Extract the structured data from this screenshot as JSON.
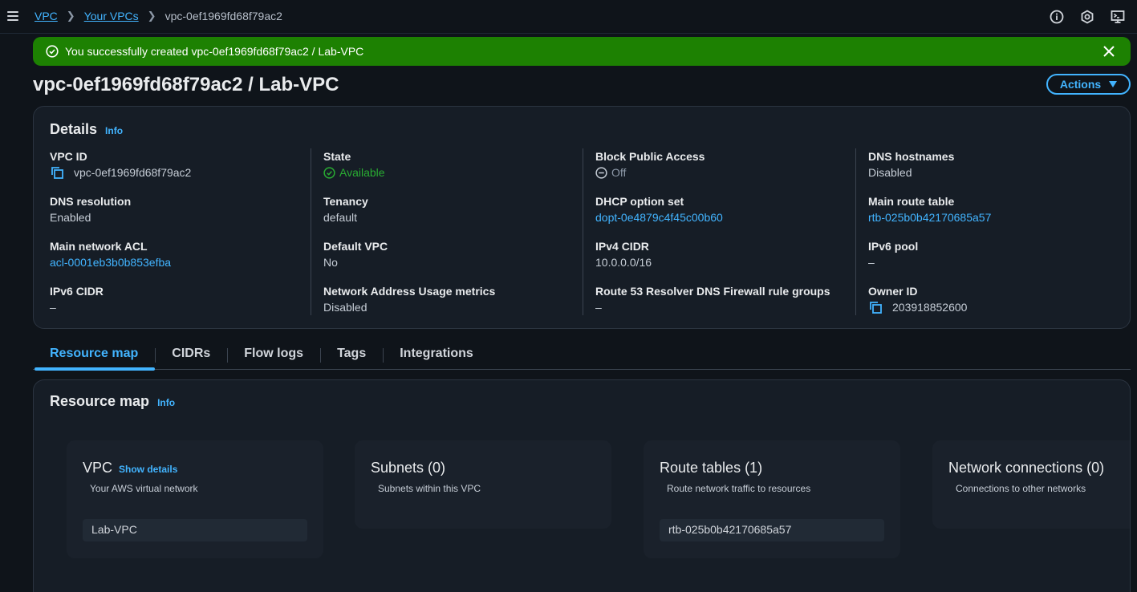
{
  "breadcrumb": {
    "items": [
      "VPC",
      "Your VPCs"
    ],
    "current": "vpc-0ef1969fd68f79ac2"
  },
  "flash": {
    "message": "You successfully created vpc-0ef1969fd68f79ac2 / Lab-VPC",
    "color": "#1d8102"
  },
  "page": {
    "title": "vpc-0ef1969fd68f79ac2 / Lab-VPC",
    "actions_label": "Actions"
  },
  "details": {
    "title": "Details",
    "info": "Info",
    "col1": [
      {
        "label": "VPC ID",
        "value": "vpc-0ef1969fd68f79ac2"
      },
      {
        "label": "DNS resolution",
        "value": "Enabled"
      },
      {
        "label": "Main network ACL",
        "value": "acl-0001eb3b0b853efba"
      },
      {
        "label": "IPv6 CIDR",
        "value": "–"
      }
    ],
    "col2": [
      {
        "label": "State",
        "value": "Available"
      },
      {
        "label": "Tenancy",
        "value": "default"
      },
      {
        "label": "Default VPC",
        "value": "No"
      },
      {
        "label": "Network Address Usage metrics",
        "value": "Disabled"
      }
    ],
    "col3": [
      {
        "label": "Block Public Access",
        "value": "Off"
      },
      {
        "label": "DHCP option set",
        "value": "dopt-0e4879c4f45c00b60"
      },
      {
        "label": "IPv4 CIDR",
        "value": "10.0.0.0/16"
      },
      {
        "label": "Route 53 Resolver DNS Firewall rule groups",
        "value": "–"
      }
    ],
    "col4": [
      {
        "label": "DNS hostnames",
        "value": "Disabled"
      },
      {
        "label": "Main route table",
        "value": "rtb-025b0b42170685a57"
      },
      {
        "label": "IPv6 pool",
        "value": "–"
      },
      {
        "label": "Owner ID",
        "value": "203918852600"
      }
    ]
  },
  "tabs": [
    "Resource map",
    "CIDRs",
    "Flow logs",
    "Tags",
    "Integrations"
  ],
  "resource_map": {
    "title": "Resource map",
    "info": "Info",
    "vpc": {
      "title": "VPC",
      "show_details": "Show details",
      "subtitle": "Your AWS virtual network",
      "item": "Lab-VPC"
    },
    "subnets": {
      "title": "Subnets (0)",
      "subtitle": "Subnets within this VPC"
    },
    "route_tables": {
      "title": "Route tables (1)",
      "subtitle": "Route network traffic to resources",
      "item": "rtb-025b0b42170685a57"
    },
    "network_connections": {
      "title": "Network connections (0)",
      "subtitle": "Connections to other networks"
    }
  },
  "colors": {
    "accent": "#42b4ff",
    "success": "#29ad32",
    "background": "#0f141a",
    "card": "#161d26"
  },
  "icons": [
    "menu-icon",
    "chevron-right-icon",
    "info-circle-icon",
    "settings-hex-icon",
    "cloudshell-icon",
    "check-circle-icon",
    "close-icon",
    "caret-down-icon",
    "copy-icon",
    "minus-circle-icon"
  ]
}
